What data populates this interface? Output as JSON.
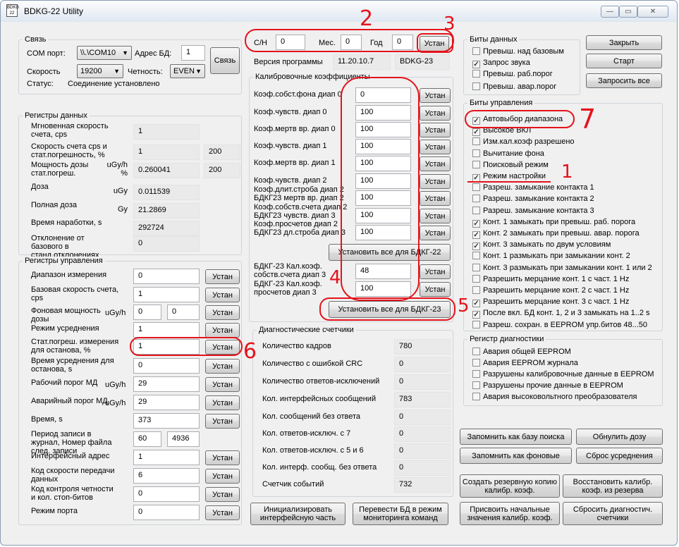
{
  "window": {
    "title": "BDKG-22 Utility",
    "icon_text": "BDKG 22",
    "min": "—",
    "max": "▭",
    "close": "✕"
  },
  "svyaz": {
    "title": "Связь",
    "com_label": "COM порт:",
    "com_value": "\\\\.\\COM10",
    "addr_label": "Адрес БД:",
    "addr_value": "1",
    "connect_btn": "Связь",
    "speed_label": "Скорость",
    "speed_value": "19200",
    "parity_label": "Четность:",
    "parity_value": "EVEN",
    "status_label": "Статус:",
    "status_value": "Соединение установлено"
  },
  "reg_data": {
    "title": "Регистры данных",
    "rows": [
      {
        "label": "Мгновенная скорость счета, cps",
        "unit": "",
        "v1": "1",
        "v2": ""
      },
      {
        "label": "Скорость счета cps и стат.погрешность, %",
        "unit": "",
        "v1": "1",
        "v2": "200"
      },
      {
        "label": "Мощность дозы стат.погреш.",
        "unit": "uGy/h %",
        "v1": "0.260041",
        "v2": "200"
      },
      {
        "label": "Доза",
        "unit": "uGy",
        "v1": "0.011539",
        "v2": ""
      },
      {
        "label": "Полная доза",
        "unit": "Gy",
        "v1": "21.2869",
        "v2": ""
      },
      {
        "label": "Время наработки, s",
        "unit": "",
        "v1": "292724",
        "v2": ""
      },
      {
        "label": "Отклонение от базового в станд.отклонениях",
        "unit": "",
        "v1": "0",
        "v2": ""
      }
    ]
  },
  "reg_ctrl": {
    "title": "Регистры управления",
    "set_label": "Устан",
    "rows": [
      {
        "label": "Диапазон измерения",
        "unit": "",
        "v1": "0",
        "v2": ""
      },
      {
        "label": "Базовая скорость счета, cps",
        "unit": "",
        "v1": "1",
        "v2": ""
      },
      {
        "label": "Фоновая мощность дозы",
        "unit": "uGy/h",
        "v1": "0",
        "v2": "0"
      },
      {
        "label": "Режим усреднения",
        "unit": "",
        "v1": "1",
        "v2": ""
      },
      {
        "label": "Стат.погреш. измерения для останова, %",
        "unit": "",
        "v1": "1",
        "v2": ""
      },
      {
        "label": "Время усреднения для останова, s",
        "unit": "",
        "v1": "0",
        "v2": ""
      },
      {
        "label": "Рабочий порог МД",
        "unit": "uGy/h",
        "v1": "29",
        "v2": ""
      },
      {
        "label": "Аварийный порог МД",
        "unit": "uGy/h",
        "v1": "29",
        "v2": ""
      },
      {
        "label": "Время, s",
        "unit": "",
        "v1": "373",
        "v2": ""
      },
      {
        "label": "Период записи в журнал, Номер файла след. записи",
        "unit": "",
        "v1": "60",
        "v2": "4936"
      },
      {
        "label": "Интерфейсный адрес",
        "unit": "",
        "v1": "1",
        "v2": ""
      },
      {
        "label": "Код скорости передачи данных",
        "unit": "",
        "v1": "6",
        "v2": ""
      },
      {
        "label": "Код контроля четности и кол. стоп-битов",
        "unit": "",
        "v1": "0",
        "v2": ""
      },
      {
        "label": "Режим порта",
        "unit": "",
        "v1": "0",
        "v2": ""
      }
    ]
  },
  "serial": {
    "sn_label": "С/Н",
    "sn_value": "0",
    "month_label": "Мес.",
    "month_value": "0",
    "year_label": "Год",
    "year_value": "0",
    "set_btn": "Устан",
    "prog_label": "Версия программы",
    "prog_version": "11.20.10.7",
    "prog_device": "BDKG-23"
  },
  "calib": {
    "title": "Калибровочные коэффициенты",
    "set_label": "Устан",
    "rows": [
      {
        "label": "Коэф.собст.фона диап 0",
        "value": "0"
      },
      {
        "label": "Коэф.чувств. диап 0",
        "value": "100"
      },
      {
        "label": "Коэф.мертв вр. диап 0",
        "value": "100"
      },
      {
        "label": "Коэф.чувств. диап 1",
        "value": "100"
      },
      {
        "label": "Коэф.мертв вр. диап 1",
        "value": "100"
      },
      {
        "label": "Коэф.чувств. диап 2",
        "value": "100"
      },
      {
        "label": "Коэф.длит.строба диап 2 БДКГ23 мертв вр. диап 2",
        "value": "100"
      },
      {
        "label": "Коэф.собств.счета диап 2 БДКГ23 чувств. диап 3",
        "value": "100"
      },
      {
        "label": "Коэф.просчетов диап 2 БДКГ23 дл.строба диап 3",
        "value": "100"
      }
    ],
    "set_all_22": "Установить все для БДКГ-22",
    "rows23": [
      {
        "label": "БДКГ-23 Кал.коэф. собств.счета диап 3",
        "value": "48"
      },
      {
        "label": "БДКГ-23 Кал.коэф. просчетов диап 3",
        "value": "100"
      }
    ],
    "set_all_23": "Установить все для БДКГ-23"
  },
  "diag": {
    "title": "Диагностические счетчики",
    "rows": [
      {
        "label": "Количество кадров",
        "value": "780"
      },
      {
        "label": "Количество с ошибкой CRC",
        "value": "0"
      },
      {
        "label": "Количество ответов-исключений",
        "value": "0"
      },
      {
        "label": "Кол. интерфейсных сообщений",
        "value": "783"
      },
      {
        "label": "Кол. сообщений без ответа",
        "value": "0"
      },
      {
        "label": "Кол. ответов-исключ. с 7",
        "value": "0"
      },
      {
        "label": "Кол. ответов-исключ. с 5 и 6",
        "value": "0"
      },
      {
        "label": "Кол. интерф. сообщ. без ответа",
        "value": "0"
      },
      {
        "label": "Счетчик событий",
        "value": "732"
      }
    ]
  },
  "bottom_mid": {
    "init_btn": "Инициализировать интерфейсную часть",
    "monitor_btn": "Перевести БД в режим мониторинга команд"
  },
  "data_bits": {
    "title": "Биты данных",
    "items": [
      {
        "label": "Превыш. над базовым",
        "checked": false
      },
      {
        "label": "Запрос звука",
        "checked": true
      },
      {
        "label": "Превыш. раб.порог",
        "checked": false
      },
      {
        "label": "Превыш. авар.порог",
        "checked": false
      }
    ]
  },
  "right_buttons": {
    "close": "Закрыть",
    "start": "Старт",
    "request_all": "Запросить все"
  },
  "ctrl_bits": {
    "title": "Биты управления",
    "items": [
      {
        "label": "Автовыбор диапазона",
        "checked": true
      },
      {
        "label": "Высокое ВКЛ",
        "checked": true
      },
      {
        "label": "Изм.кал.коэф разрешено",
        "checked": false
      },
      {
        "label": "Вычитание фона",
        "checked": false
      },
      {
        "label": "Поисковый режим",
        "checked": false
      },
      {
        "label": "Режим настройки",
        "checked": true
      },
      {
        "label": "Разреш. замыкание контакта 1",
        "checked": false
      },
      {
        "label": "Разреш. замыкание контакта 2",
        "checked": false
      },
      {
        "label": "Разреш. замыкание контакта 3",
        "checked": false
      },
      {
        "label": "Конт. 1 замыкать при превыш. раб. порога",
        "checked": true
      },
      {
        "label": "Конт. 2 замыкать при превыш. авар. порога",
        "checked": true
      },
      {
        "label": "Конт. 3 замыкать по двум условиям",
        "checked": true
      },
      {
        "label": "Конт. 1 размыкать при замыкании конт. 2",
        "checked": false
      },
      {
        "label": "Конт. 3 размыкать при замыкании конт. 1 или 2",
        "checked": false
      },
      {
        "label": "Разрешить мерцание конт. 1 с част. 1 Hz",
        "checked": false
      },
      {
        "label": "Разрешить мерцание конт. 2 с част. 1 Hz",
        "checked": false
      },
      {
        "label": "Разрешить мерцание конт. 3 с част. 1 Hz",
        "checked": true
      },
      {
        "label": "После вкл. БД конт. 1, 2 и 3 замыкать на 1..2 s",
        "checked": true
      },
      {
        "label": "Разреш. сохран. в EEPROM упр.битов 48...50",
        "checked": false
      }
    ]
  },
  "diag_reg": {
    "title": "Регистр диагностики",
    "items": [
      {
        "label": "Авария общей EEPROM",
        "checked": false
      },
      {
        "label": "Авария EEPROM журнала",
        "checked": false
      },
      {
        "label": "Разрушены калибровочные данные в EEPROM",
        "checked": false
      },
      {
        "label": "Разрушены прочие данные в EEPROM",
        "checked": false
      },
      {
        "label": "Авария высоковольтного преобразователя",
        "checked": false
      }
    ]
  },
  "bottom_right": {
    "save_search": "Запомнить как базу поиска",
    "reset_dose": "Обнулить дозу",
    "save_bg": "Запомнить как фоновые",
    "reset_avg": "Сброс усреднения",
    "backup": "Создать резервную копию калибр. коэф.",
    "restore": "Восстановить калибр. коэф. из резерва",
    "assign_init": "Присвоить начальные значения калибр. коэф.",
    "reset_diag": "Сбросить диагностич. счетчики"
  },
  "annotations": {
    "n1": "1",
    "n2": "2",
    "n3": "3",
    "n4": "4",
    "n5": "5",
    "n6": "6",
    "n7": "7",
    "color": "#e4131b"
  }
}
